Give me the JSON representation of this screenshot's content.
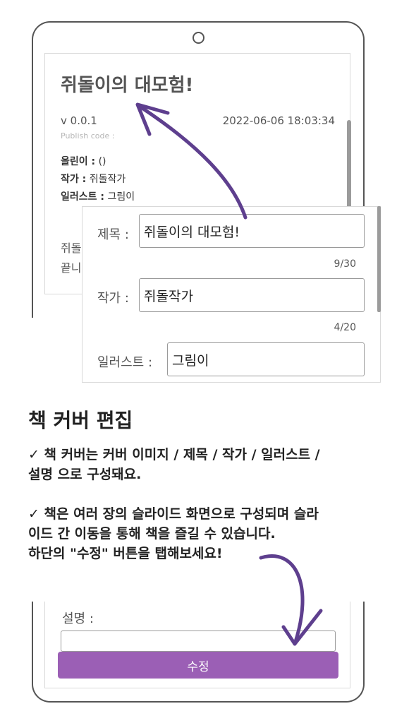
{
  "book": {
    "title": "쥐돌이의 대모험!",
    "version": "v 0.0.1",
    "date": "2022-06-06 18:03:34",
    "publish_code_label": "Publish code :",
    "uploader_label": "올린이 :",
    "uploader_value": "()",
    "author_label": "작가 :",
    "author_value": "쥐돌작가",
    "illustrator_label": "일러스트 :",
    "illustrator_value": "그림이",
    "desc_line1": "쥐돌",
    "desc_line2": "끝니"
  },
  "edit_panel": {
    "title_label": "제목 :",
    "title_value": "쥐돌이의 대모험!",
    "title_counter": "9/30",
    "author_label": "작가 :",
    "author_value": "쥐돌작가",
    "author_counter": "4/20",
    "illustrator_label": "일러스트 :",
    "illustrator_value": "그림이"
  },
  "guide": {
    "heading": "책 커버 편집",
    "p1_line1": "✓ 책 커버는 커버 이미지 / 제목 / 작가 / 일러스트 /",
    "p1_line2": "설명 으로 구성돼요.",
    "p2_line1": "✓ 책은 여러 장의 슬라이드 화면으로 구성되며 슬라",
    "p2_line2": "이드 간 이동을 통해 책을 즐길 수 있습니다.",
    "p2_line3": "하단의 \"수정\" 버튼을 탭해보세요!"
  },
  "bottom": {
    "desc_label": "설명 :",
    "edit_button": "수정"
  },
  "colors": {
    "accent": "#9b5fb5",
    "arrow": "#5e3f8e"
  }
}
